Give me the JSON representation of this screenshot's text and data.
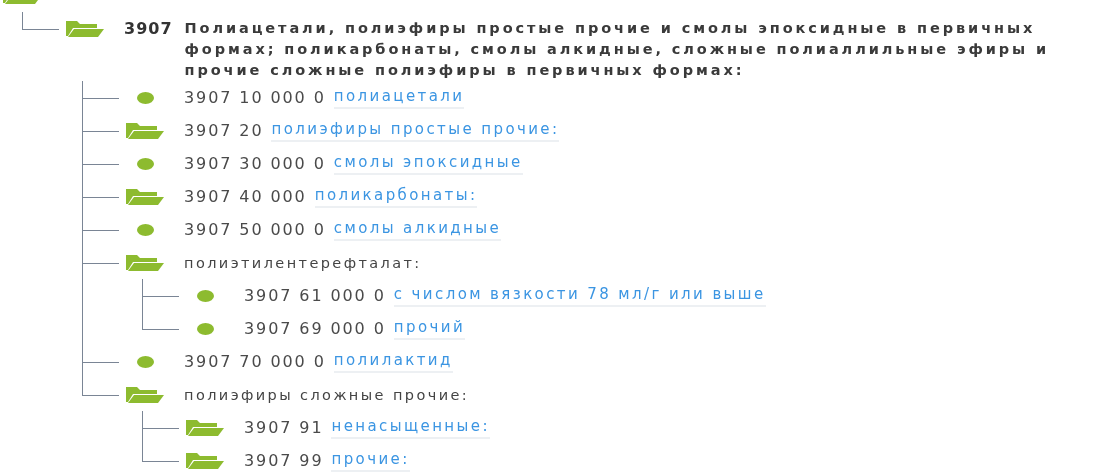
{
  "tree": {
    "kind": "folder",
    "children": [
      {
        "kind": "folder",
        "code": "3907",
        "label": "Полиацетали, полиэфиры простые прочие и смолы эпоксидные в первичных формах; поликарбонаты, смолы алкидные, сложные полиаллильные эфиры и прочие сложные полиэфиры в первичных формах:",
        "bold": true,
        "children": [
          {
            "kind": "leaf",
            "code": "3907 10 000 0",
            "label": "полиацетали",
            "link": true
          },
          {
            "kind": "folder",
            "code": "3907 20",
            "label": "полиэфиры простые прочие:",
            "link": true
          },
          {
            "kind": "leaf",
            "code": "3907 30 000 0",
            "label": "смолы эпоксидные",
            "link": true
          },
          {
            "kind": "folder",
            "code": "3907 40 000",
            "label": "поликарбонаты:",
            "link": true
          },
          {
            "kind": "leaf",
            "code": "3907 50 000 0",
            "label": "смолы алкидные",
            "link": true
          },
          {
            "kind": "folder",
            "label": "полиэтилентерефталат:",
            "link": false,
            "children": [
              {
                "kind": "leaf",
                "code": "3907 61 000 0",
                "label": "с числом вязкости 78 мл/г или выше",
                "link": true
              },
              {
                "kind": "leaf",
                "code": "3907 69 000 0",
                "label": "прочий",
                "link": true
              }
            ]
          },
          {
            "kind": "leaf",
            "code": "3907 70 000 0",
            "label": "полилактид",
            "link": true
          },
          {
            "kind": "folder",
            "label": "полиэфиры сложные прочие:",
            "link": false,
            "children": [
              {
                "kind": "folder",
                "code": "3907 91",
                "label": "ненасыщенные:",
                "link": true
              },
              {
                "kind": "folder",
                "code": "3907 99",
                "label": "прочие:",
                "link": true
              }
            ]
          }
        ]
      }
    ]
  }
}
